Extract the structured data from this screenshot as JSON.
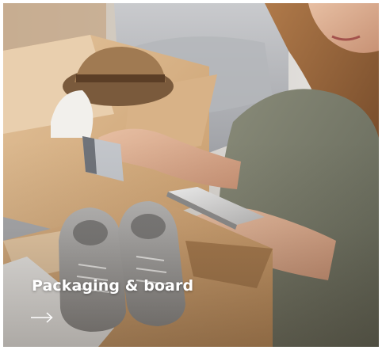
{
  "card": {
    "title": "Packaging & board",
    "arrow_icon": "arrow-right-icon",
    "image_subject": "photo",
    "colors": {
      "title_text": "#ffffff",
      "arrow": "#ffffff"
    }
  }
}
